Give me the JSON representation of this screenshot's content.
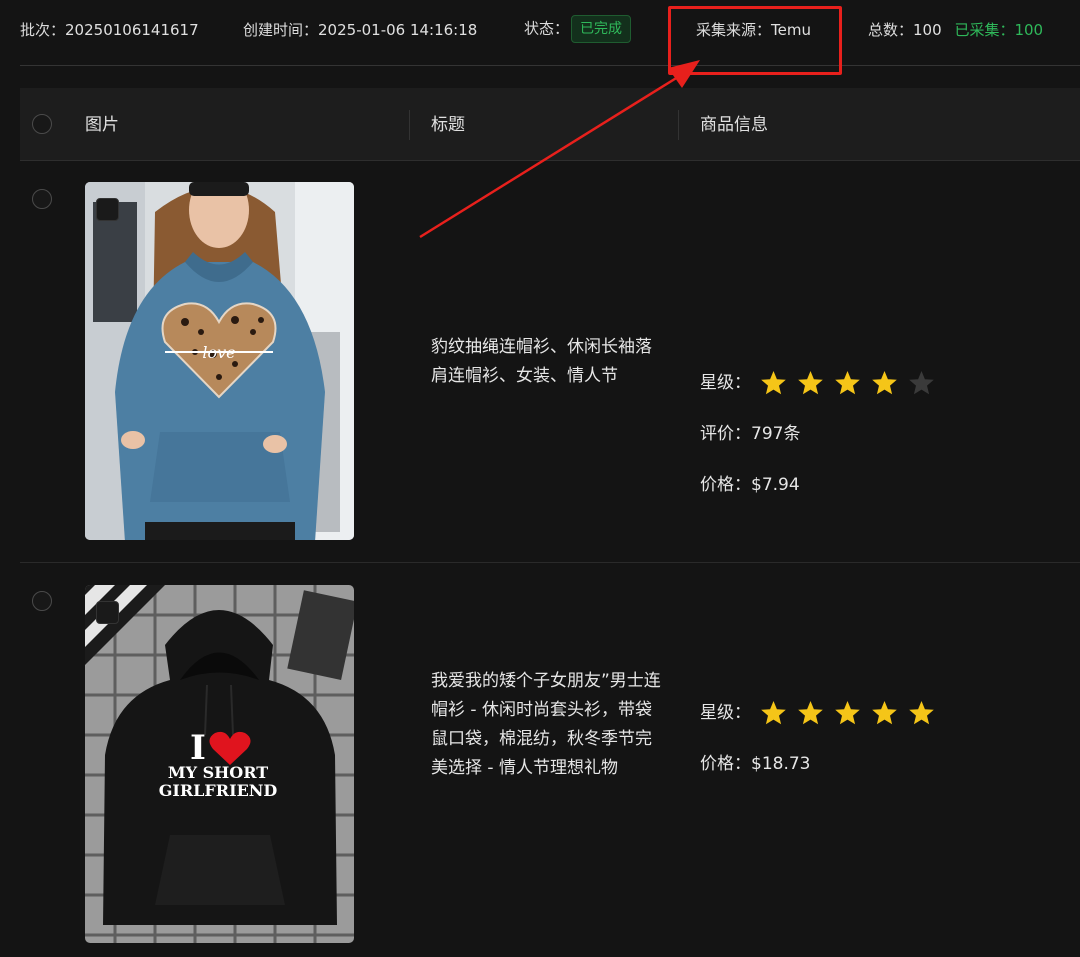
{
  "meta": {
    "batch_label": "批次：",
    "batch_value": "20250106141617",
    "created_label": "创建时间：",
    "created_value": "2025-01-06 14:16:18",
    "status_label": "状态：",
    "status_value": "已完成",
    "source_label": "采集来源：",
    "source_value": "Temu",
    "total_label": "总数：",
    "total_value": "100",
    "collected_label": "已采集：",
    "collected_value": "100"
  },
  "table": {
    "columns": [
      "图片",
      "标题",
      "商品信息"
    ]
  },
  "products": [
    {
      "title": "豹纹抽绳连帽衫、休闲长袖落肩连帽衫、女装、情人节",
      "rating_label": "星级：",
      "rating": 4,
      "rating_max": 5,
      "reviews_label": "评价：",
      "reviews_value": "797条",
      "price_label": "价格：",
      "price_value": "$7.94",
      "image_text": "love"
    },
    {
      "title": "我爱我的矮个子女朋友”男士连帽衫 - 休闲时尚套头衫，带袋鼠口袋，棉混纺，秋冬季节完美选择 - 情人节理想礼物",
      "rating_label": "星级：",
      "rating": 5,
      "rating_max": 5,
      "price_label": "价格：",
      "price_value": "$18.73",
      "image_text": [
        "I",
        "MY SHORT",
        "GIRLFRIEND"
      ]
    }
  ],
  "colors": {
    "background": "#141414",
    "accent_green": "#2fb85a",
    "highlight_red": "#e8201c",
    "star_filled": "#f5c518",
    "star_empty": "#3a3a3a"
  },
  "icons": [
    "checkbox-icon",
    "star-icon",
    "heart-icon",
    "annotation-arrow"
  ]
}
